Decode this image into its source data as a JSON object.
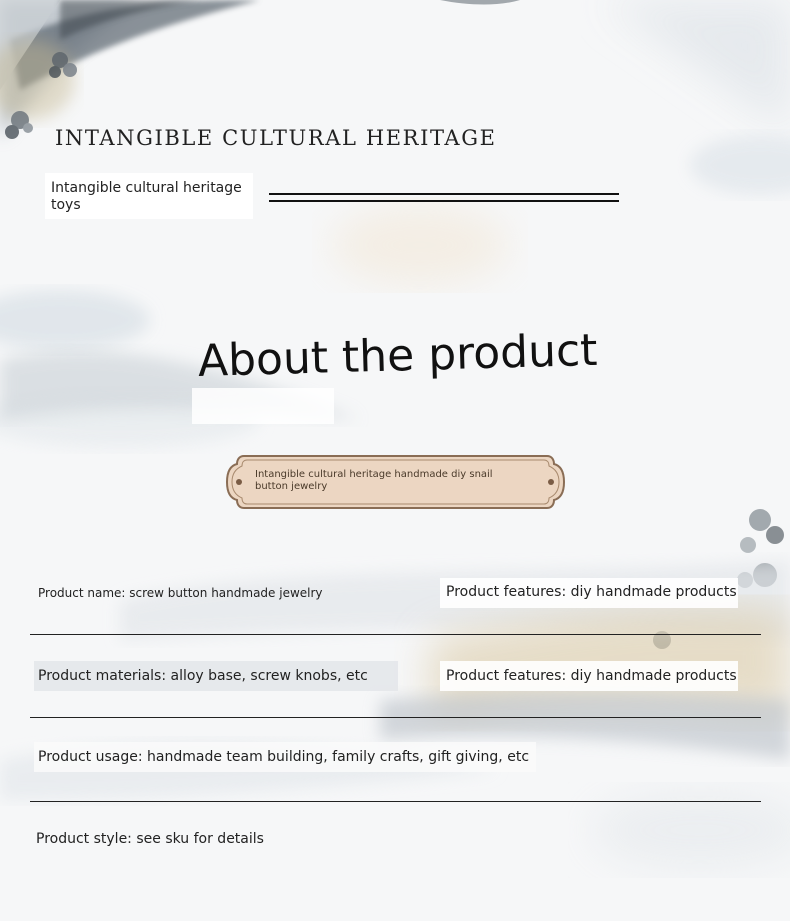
{
  "header": {
    "heritage_title": "INTANGIBLE CULTURAL HERITAGE",
    "subtitle": "Intangible cultural heritage toys"
  },
  "about": {
    "title": "About the product",
    "plaque_text": "Intangible cultural heritage handmade diy snail button jewelry"
  },
  "details": {
    "name": "Product name: screw button handmade jewelry",
    "features_1": "Product features: diy handmade products",
    "materials": "Product materials: alloy base, screw knobs, etc",
    "features_2": "Product features: diy handmade products",
    "usage": "Product usage: handmade team building, family crafts, gift giving, etc",
    "style": "Product style: see sku for details"
  },
  "colors": {
    "plaque_fill": "#ecd6c2",
    "plaque_border": "#8a6d55",
    "accent_gold": "#c8b27c",
    "ink": "#1f1f1f"
  }
}
